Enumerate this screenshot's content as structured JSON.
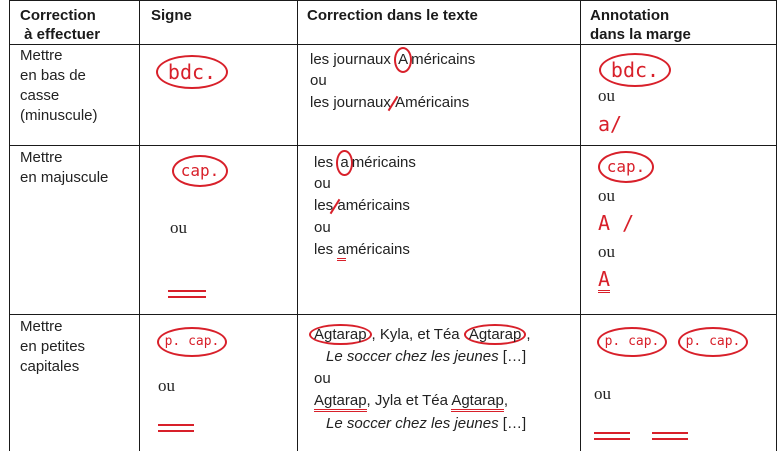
{
  "headers": {
    "col1": "Correction\n à effectuer",
    "col2": "Signe",
    "col3": "Correction dans le texte",
    "col4": "Annotation\ndans la marge"
  },
  "rows": [
    {
      "label": "Mettre\nen bas de\ncasse\n(minuscule)",
      "sign": "bdc.",
      "text": {
        "l1_pre": "les journaux ",
        "l1_mark": "A",
        "l1_post": "méricains",
        "or1": "ou",
        "l3_pre": "les journaux ",
        "l3_mark": "A",
        "l3_post": "méricains"
      },
      "margin": {
        "sign": "bdc.",
        "or": "ou",
        "alt": "a/"
      }
    },
    {
      "label": "Mettre\nen majuscule",
      "sign": "cap.",
      "or": "ou",
      "text": {
        "l1_pre": "les ",
        "l1_mark": "a",
        "l1_post": "méricains",
        "or1": "ou",
        "l3_pre": "les ",
        "l3_mark": "a",
        "l3_post": "méricains",
        "or2": "ou",
        "l5_pre": "les ",
        "l5_mark": "a",
        "l5_post": "méricains"
      },
      "margin": {
        "sign": "cap.",
        "or1": "ou",
        "alt1": "A /",
        "or2": "ou",
        "alt2": "A"
      }
    },
    {
      "label": "Mettre\nen petites\ncapitales",
      "sign": "p. cap.",
      "or": "ou",
      "text": {
        "l1_a": "Agtarap",
        "l1_b": ", Kyla, et Téa ",
        "l1_c": "Agtarap",
        "l1_d": ",",
        "l2": "Le soccer chez les jeunes",
        "l2_tail": " […]",
        "or1": "ou",
        "l3_a": "Agtarap",
        "l3_b": ", Jyla et Téa ",
        "l3_c": "Agtarap",
        "l3_d": ",",
        "l4": "Le soccer chez les jeunes",
        "l4_tail": " […]"
      },
      "margin": {
        "sign1": "p. cap.",
        "sign2": "p. cap.",
        "or": "ou"
      }
    }
  ],
  "colors": {
    "ink": "#d8202a",
    "rule": "#1a1a1a"
  }
}
